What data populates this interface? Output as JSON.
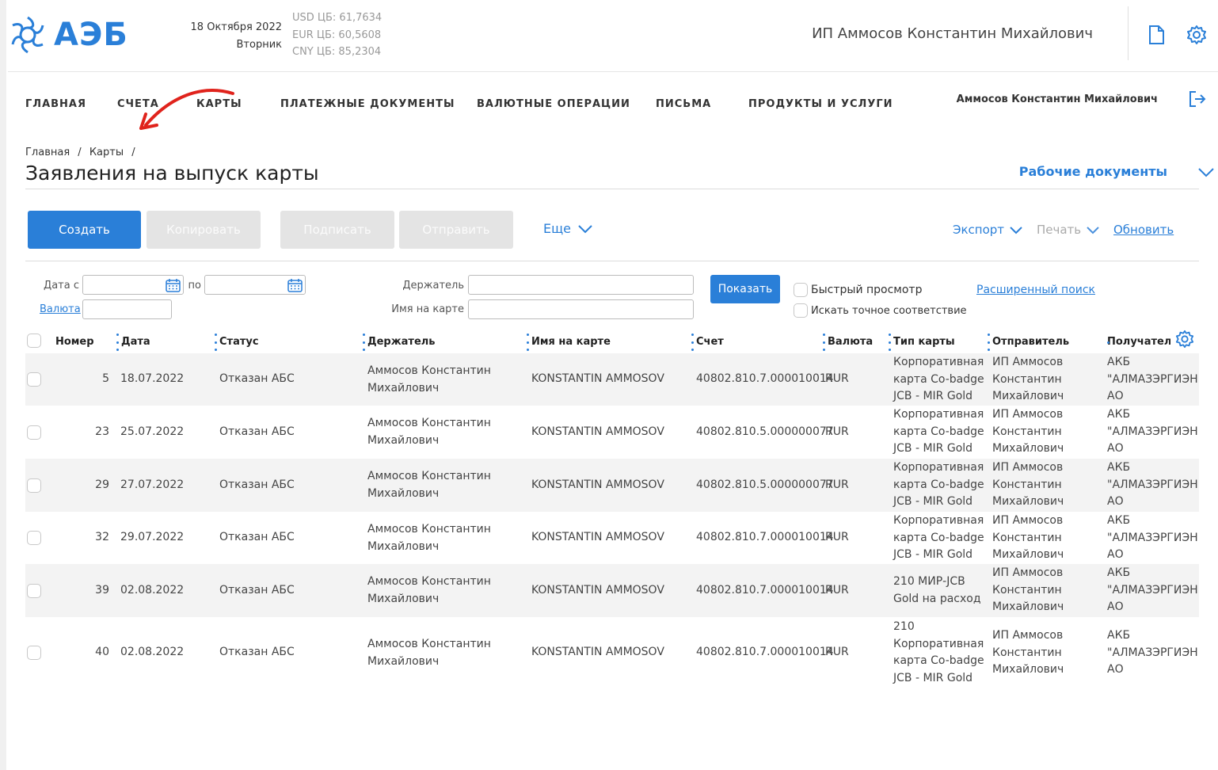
{
  "header": {
    "logo_text": "АЭБ",
    "date": "18 Октября 2022",
    "weekday": "Вторник",
    "rates": [
      "USD ЦБ: 61,7634",
      "EUR ЦБ: 60,5608",
      "CNY ЦБ: 85,2304"
    ],
    "org_name": "ИП Аммосов Константин Михайлович"
  },
  "nav": {
    "items": [
      "ГЛАВНАЯ",
      "СЧЕТА",
      "КАРТЫ",
      "ПЛАТЕЖНЫЕ ДОКУМЕНТЫ",
      "ВАЛЮТНЫЕ ОПЕРАЦИИ",
      "ПИСЬМА",
      "ПРОДУКТЫ И УСЛУГИ"
    ],
    "user_name": "Аммосов Константин Михайлович"
  },
  "breadcrumb": [
    "Главная",
    "/",
    "Карты",
    "/"
  ],
  "page_title": "Заявления на выпуск карты",
  "work_docs": "Рабочие документы",
  "toolbar": {
    "create": "Создать",
    "copy": "Копировать",
    "sign": "Подписать",
    "send": "Отправить",
    "more": "Еще",
    "export": "Экспорт",
    "print": "Печать",
    "refresh": "Обновить"
  },
  "filters": {
    "date_from": "Дата с",
    "date_to": "по",
    "currency": "Валюта",
    "holder": "Держатель",
    "name_on_card": "Имя на карте",
    "show": "Показать",
    "quick_view": "Быстрый просмотр",
    "exact_match": "Искать точное соответствие",
    "advanced_search": "Расширенный поиск"
  },
  "table": {
    "headers": [
      "Номер",
      "Дата",
      "Статус",
      "Держатель",
      "Имя на карте",
      "Счет",
      "Валюта",
      "Тип карты",
      "Отправитель",
      "Получатель"
    ],
    "rows": [
      {
        "num": "5",
        "date": "18.07.2022",
        "status": "Отказан АБС",
        "holder": [
          "Аммосов Константин",
          "Михайлович"
        ],
        "card_name": "KONSTANTIN AMMOSOV",
        "account": "40802.810.7.000010014",
        "currency": "RUR",
        "card_type": [
          "Корпоративная",
          "карта Co-badge",
          "JCB - MIR Gold"
        ],
        "sender": [
          "ИП Аммосов",
          "Константин",
          "Михайлович"
        ],
        "receiver": [
          "АКБ",
          "\"АЛМАЗЭРГИЭНБАНК\"",
          "АО"
        ]
      },
      {
        "num": "23",
        "date": "25.07.2022",
        "status": "Отказан АБС",
        "holder": [
          "Аммосов Константин",
          "Михайлович"
        ],
        "card_name": "KONSTANTIN AMMOSOV",
        "account": "40802.810.5.000000077",
        "currency": "RUR",
        "card_type": [
          "Корпоративная",
          "карта Co-badge",
          "JCB - MIR Gold"
        ],
        "sender": [
          "ИП Аммосов",
          "Константин",
          "Михайлович"
        ],
        "receiver": [
          "АКБ",
          "\"АЛМАЗЭРГИЭНБАНК\"",
          "АО"
        ]
      },
      {
        "num": "29",
        "date": "27.07.2022",
        "status": "Отказан АБС",
        "holder": [
          "Аммосов Константин",
          "Михайлович"
        ],
        "card_name": "KONSTANTIN AMMOSOV",
        "account": "40802.810.5.000000077",
        "currency": "RUR",
        "card_type": [
          "Корпоративная",
          "карта Co-badge",
          "JCB - MIR Gold"
        ],
        "sender": [
          "ИП Аммосов",
          "Константин",
          "Михайлович"
        ],
        "receiver": [
          "АКБ",
          "\"АЛМАЗЭРГИЭНБАНК\"",
          "АО"
        ]
      },
      {
        "num": "32",
        "date": "29.07.2022",
        "status": "Отказан АБС",
        "holder": [
          "Аммосов Константин",
          "Михайлович"
        ],
        "card_name": "KONSTANTIN AMMOSOV",
        "account": "40802.810.7.000010014",
        "currency": "RUR",
        "card_type": [
          "Корпоративная",
          "карта Co-badge",
          "JCB - MIR Gold"
        ],
        "sender": [
          "ИП Аммосов",
          "Константин",
          "Михайлович"
        ],
        "receiver": [
          "АКБ",
          "\"АЛМАЗЭРГИЭНБАНК\"",
          "АО"
        ]
      },
      {
        "num": "39",
        "date": "02.08.2022",
        "status": "Отказан АБС",
        "holder": [
          "Аммосов Константин",
          "Михайлович"
        ],
        "card_name": "KONSTANTIN AMMOSOV",
        "account": "40802.810.7.000010014",
        "currency": "RUR",
        "card_type": [
          "210 МИР-JCB",
          "Gold на расход"
        ],
        "sender": [
          "ИП Аммосов",
          "Константин",
          "Михайлович"
        ],
        "receiver": [
          "АКБ",
          "\"АЛМАЗЭРГИЭНБАНК\"",
          "АО"
        ]
      },
      {
        "num": "40",
        "date": "02.08.2022",
        "status": "Отказан АБС",
        "holder": [
          "Аммосов Константин",
          "Михайлович"
        ],
        "card_name": "KONSTANTIN AMMOSOV",
        "account": "40802.810.7.000010014",
        "currency": "RUR",
        "card_type": [
          "210",
          "Корпоративная",
          "карта Co-badge",
          "JCB - MIR Gold"
        ],
        "sender": [
          "ИП Аммосов",
          "Константин",
          "Михайлович"
        ],
        "receiver": [
          "АКБ",
          "\"АЛМАЗЭРГИЭНБАНК\"",
          "АО"
        ]
      }
    ]
  },
  "colors": {
    "accent": "#2a7fd8",
    "annotation_arrow": "#e0231c",
    "row_shade": "#f3f3f3"
  }
}
